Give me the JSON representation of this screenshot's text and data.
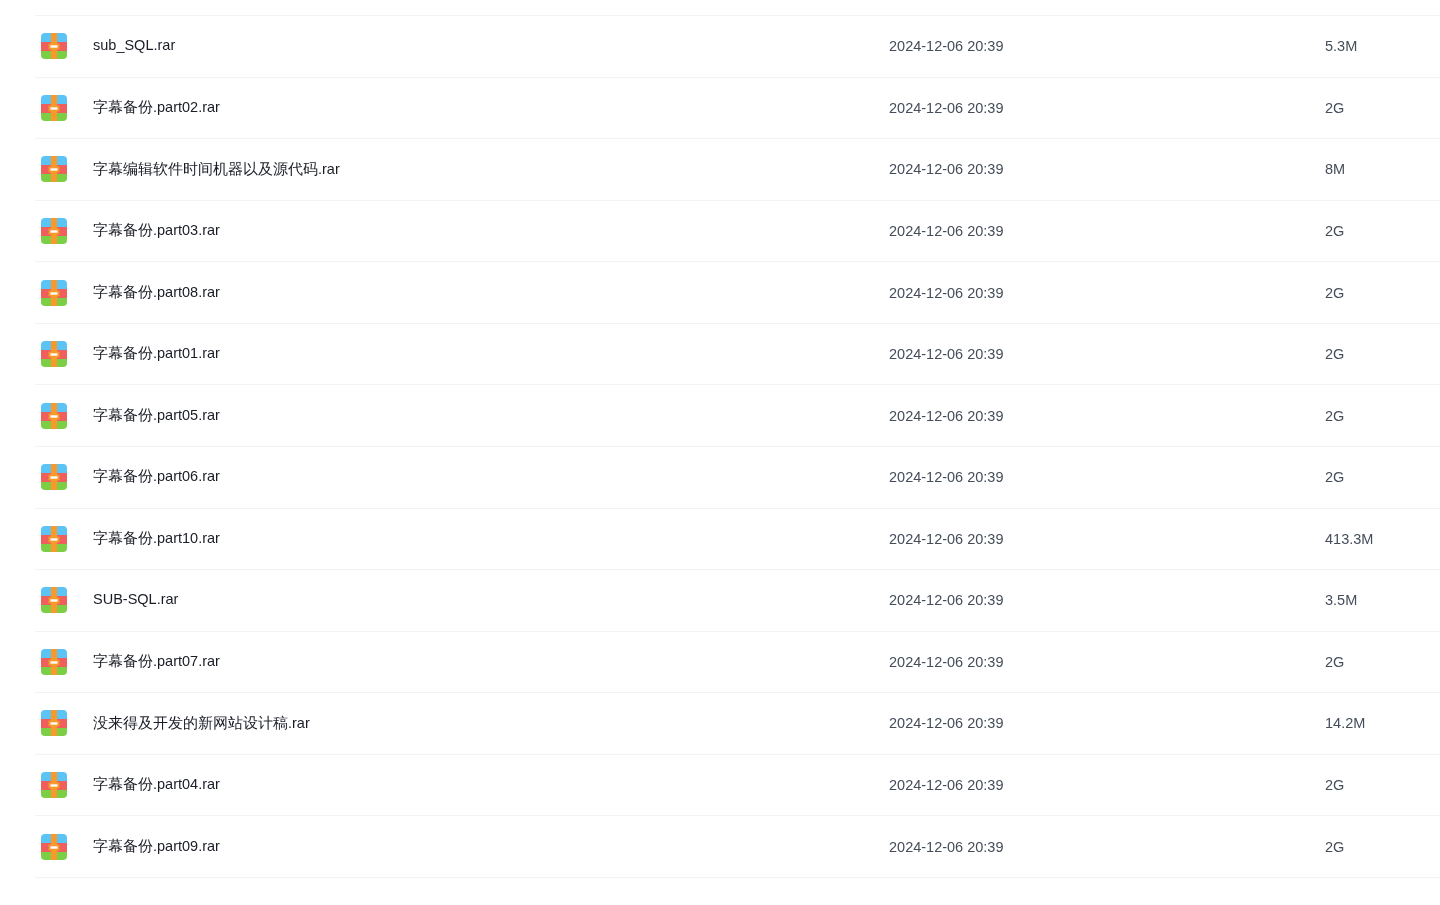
{
  "files": [
    {
      "name": "sub_SQL.rar",
      "modified": "2024-12-06 20:39",
      "size": "5.3M"
    },
    {
      "name": "字幕备份.part02.rar",
      "modified": "2024-12-06 20:39",
      "size": "2G"
    },
    {
      "name": "字幕编辑软件时间机器以及源代码.rar",
      "modified": "2024-12-06 20:39",
      "size": "8M"
    },
    {
      "name": "字幕备份.part03.rar",
      "modified": "2024-12-06 20:39",
      "size": "2G"
    },
    {
      "name": "字幕备份.part08.rar",
      "modified": "2024-12-06 20:39",
      "size": "2G"
    },
    {
      "name": "字幕备份.part01.rar",
      "modified": "2024-12-06 20:39",
      "size": "2G"
    },
    {
      "name": "字幕备份.part05.rar",
      "modified": "2024-12-06 20:39",
      "size": "2G"
    },
    {
      "name": "字幕备份.part06.rar",
      "modified": "2024-12-06 20:39",
      "size": "2G"
    },
    {
      "name": "字幕备份.part10.rar",
      "modified": "2024-12-06 20:39",
      "size": "413.3M"
    },
    {
      "name": "SUB-SQL.rar",
      "modified": "2024-12-06 20:39",
      "size": "3.5M"
    },
    {
      "name": "字幕备份.part07.rar",
      "modified": "2024-12-06 20:39",
      "size": "2G"
    },
    {
      "name": "没来得及开发的新网站设计稿.rar",
      "modified": "2024-12-06 20:39",
      "size": "14.2M"
    },
    {
      "name": "字幕备份.part04.rar",
      "modified": "2024-12-06 20:39",
      "size": "2G"
    },
    {
      "name": "字幕备份.part09.rar",
      "modified": "2024-12-06 20:39",
      "size": "2G"
    }
  ]
}
